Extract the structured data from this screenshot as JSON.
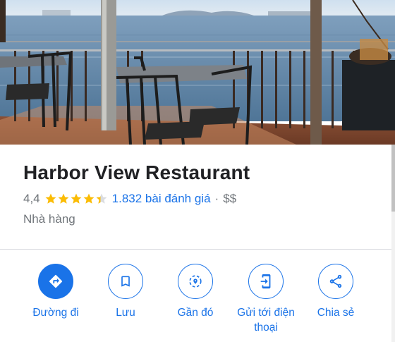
{
  "place": {
    "name": "Harbor View Restaurant",
    "rating_text": "4,4",
    "rating": 4.4,
    "stars_total": 5,
    "reviews_text": "1.832 bài đánh giá",
    "separator": "·",
    "price": "$$",
    "category": "Nhà hàng"
  },
  "hero": {
    "icon": "restaurant-photo",
    "description": "photo"
  },
  "actions": [
    {
      "id": "directions",
      "label": "Đường đi",
      "icon": "directions-icon",
      "primary": true
    },
    {
      "id": "save",
      "label": "Lưu",
      "icon": "bookmark-icon",
      "primary": false
    },
    {
      "id": "nearby",
      "label": "Gần đó",
      "icon": "nearby-icon",
      "primary": false
    },
    {
      "id": "send",
      "label": "Gửi tới điện thoại",
      "icon": "send-to-phone-icon",
      "primary": false
    },
    {
      "id": "share",
      "label": "Chia sẻ",
      "icon": "share-icon",
      "primary": false
    }
  ],
  "colors": {
    "accent": "#1a73e8",
    "star": "#fbbc04",
    "text": "#202124",
    "secondary": "#70757a"
  }
}
